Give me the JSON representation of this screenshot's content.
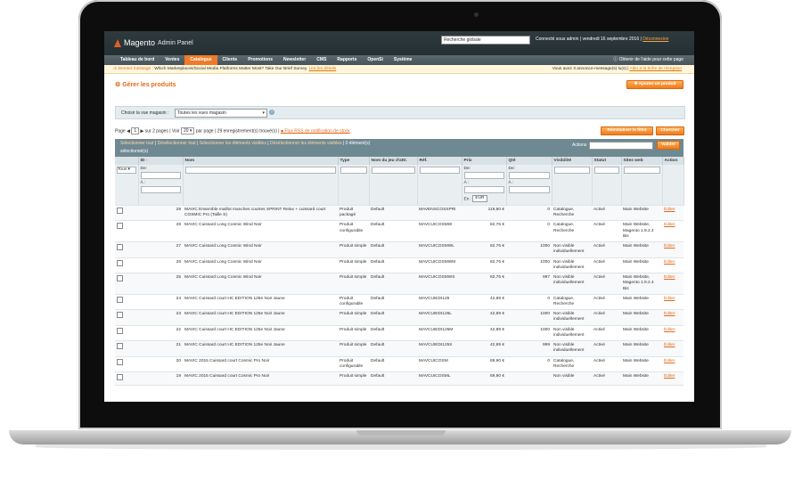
{
  "header": {
    "logo_text": "Magento",
    "logo_sub": "Admin Panel",
    "search_value": "Recherche globale",
    "user_text": "Connecté sous admin",
    "date_text": "vendredi 16 septembre 2016",
    "logout": "Déconnexion"
  },
  "nav": {
    "items": [
      "Tableau de bord",
      "Ventes",
      "Catalogue",
      "Clients",
      "Promotions",
      "Newsletter",
      "CMS",
      "Rapports",
      "OpenSi",
      "Système"
    ],
    "active_index": 2,
    "help": "Obtenir de l'aide pour cette page"
  },
  "message": {
    "label": "Dernier message :",
    "text": "Which Marketplaces/Social Media Platforms Matter Most? Take Our Brief Survey.",
    "link": "Lire les détails",
    "right_text": "Vous avez 3 annonce-message(s) lu(s)",
    "right_link": "Aller à la boîte de réception"
  },
  "page": {
    "title": "Gérer les produits",
    "add_button": "Ajouter un produit"
  },
  "store": {
    "label": "Choisir la vue magasin :",
    "value": "Toutes les vues magasin"
  },
  "pager": {
    "page_label": "Page",
    "page_value": "1",
    "of_pages": "sur 2 pages",
    "view_label": "Voir",
    "view_value": "20",
    "per_page": "par page",
    "found": "29 enregistrement(s) trouvé(s)",
    "rss": "Flux RSS de notification de stock",
    "reset_button": "Réinitialiser le filtre",
    "search_button": "Chercher"
  },
  "mass": {
    "select_all": "Sélectionner tout",
    "unselect_all": "Désélectionner tout",
    "select_visible": "Sélectionner les éléments visibles",
    "unselect_visible": "Désélectionner les éléments visibles",
    "count": "0 élément(s)",
    "selected": "sélectionné(s)",
    "actions_label": "Actions",
    "submit_button": "Valider"
  },
  "grid": {
    "columns": [
      "",
      "ID",
      "Nom",
      "Type",
      "Nom du jeu d'attr.",
      "Réf.",
      "Prix",
      "Qté",
      "Visibilité",
      "Statut",
      "Sites web",
      "Action"
    ],
    "filter": {
      "any": "Tous",
      "from": "De:",
      "to": "À :",
      "currency_label": "En :",
      "currency": "EUR"
    },
    "rows": [
      {
        "id": "29",
        "name": "MAVIC Ensemble maillot manches courtes SPRINT Relax + cuissard court COSMIC Pro (Taille S)",
        "type": "Produit packagé",
        "attr": "Default",
        "sku": "MAVENSCOSSPRI",
        "price": "119,80 €",
        "qty": "0",
        "visibility": "Catalogue, Recherche",
        "status": "Activé",
        "website": "Main Website",
        "action": "Éditer"
      },
      {
        "id": "28",
        "name": "MAVIC Cuissard Long Cosmic Wind Noir",
        "type": "Produit configurable",
        "attr": "Default",
        "sku": "MAVCUICOSMW",
        "price": "82,76 €",
        "qty": "0",
        "visibility": "Catalogue, Recherche",
        "status": "Activé",
        "website": "Main Website, Magento 1.9.2.4 Bis",
        "action": "Éditer"
      },
      {
        "id": "27",
        "name": "MAVIC Cuissard Long Cosmic Wind Noir",
        "type": "Produit simple",
        "attr": "Default",
        "sku": "MAVCUICOSMWL",
        "price": "82,76 €",
        "qty": "1000",
        "visibility": "Non visible individuellement",
        "status": "Activé",
        "website": "Main Website",
        "action": "Éditer"
      },
      {
        "id": "26",
        "name": "MAVIC Cuissard Long Cosmic Wind Noir",
        "type": "Produit simple",
        "attr": "Default",
        "sku": "MAVCUICOSMWM",
        "price": "82,76 €",
        "qty": "1000",
        "visibility": "Non visible individuellement",
        "status": "Activé",
        "website": "Main Website",
        "action": "Éditer"
      },
      {
        "id": "25",
        "name": "MAVIC Cuissard Long Cosmic Wind Noir",
        "type": "Produit simple",
        "attr": "Default",
        "sku": "MAVCUICOSMWS",
        "price": "82,76 €",
        "qty": "997",
        "visibility": "Non visible individuellement",
        "status": "Activé",
        "website": "Main Website, Magento 1.9.2.4 Bis",
        "action": "Éditer"
      },
      {
        "id": "24",
        "name": "MAVIC Cuissard court HC EDITION 125e Noir Jaune",
        "type": "Produit configurable",
        "attr": "Default",
        "sku": "MAVCUIEDI125",
        "price": "42,89 €",
        "qty": "0",
        "visibility": "Catalogue, Recherche",
        "status": "Activé",
        "website": "Main Website",
        "action": "Éditer"
      },
      {
        "id": "23",
        "name": "MAVIC Cuissard court HC EDITION 125e Noir Jaune",
        "type": "Produit simple",
        "attr": "Default",
        "sku": "MAVCUIEDI125L",
        "price": "42,89 €",
        "qty": "1000",
        "visibility": "Non visible individuellement",
        "status": "Activé",
        "website": "Main Website",
        "action": "Éditer"
      },
      {
        "id": "22",
        "name": "MAVIC Cuissard court HC EDITION 125e Noir Jaune",
        "type": "Produit simple",
        "attr": "Default",
        "sku": "MAVCUIEDI125M",
        "price": "42,89 €",
        "qty": "1000",
        "visibility": "Non visible individuellement",
        "status": "Activé",
        "website": "Main Website",
        "action": "Éditer"
      },
      {
        "id": "21",
        "name": "MAVIC Cuissard court HC EDITION 125e Noir Jaune",
        "type": "Produit simple",
        "attr": "Default",
        "sku": "MAVCUIEDI125S",
        "price": "42,89 €",
        "qty": "999",
        "visibility": "Non visible individuellement",
        "status": "Activé",
        "website": "Main Website",
        "action": "Éditer"
      },
      {
        "id": "20",
        "name": "MAVIC 2015 Cuissard court Cosmic Pro Noir",
        "type": "Produit configurable",
        "attr": "Default",
        "sku": "MAVCUICOSM",
        "price": "69,90 €",
        "qty": "0",
        "visibility": "Catalogue, Recherche",
        "status": "Activé",
        "website": "Main Website",
        "action": "Éditer"
      },
      {
        "id": "19",
        "name": "MAVIC 2015 Cuissard court Cosmic Pro Noir",
        "type": "Produit simple",
        "attr": "Default",
        "sku": "MAVCUICOSML",
        "price": "69,90 €",
        "qty": "",
        "visibility": "Non visible",
        "status": "Activé",
        "website": "Main Website",
        "action": "Éditer"
      }
    ]
  },
  "colors": {
    "accent": "#ef7b2a",
    "header_bg": "#2f3a3f",
    "nav_bg": "#4f5d63",
    "link": "#e36a1b"
  }
}
